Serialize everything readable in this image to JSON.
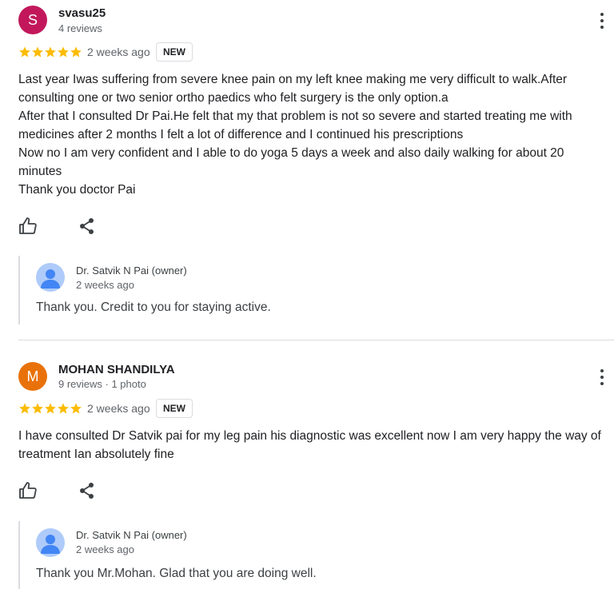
{
  "reviews": [
    {
      "avatar_letter": "S",
      "avatar_color": "#c2185b",
      "name": "svasu25",
      "meta": "4 reviews",
      "rating": 5,
      "date": "2 weeks ago",
      "badge": "NEW",
      "text_lines": [
        "Last year Iwas suffering from severe knee pain on my left knee making me very difficult to walk.After consulting one or two senior ortho paedics who felt surgery is the only option.a",
        "After that I consulted Dr Pai.He felt that my that problem is not so severe and started treating me with medicines after 2 months I felt a lot of difference and I continued his prescriptions",
        "Now no I am very confident and I able to do yoga 5 days a week and also daily walking for about 20 minutes",
        "Thank you doctor Pai"
      ],
      "reply": {
        "owner_name": "Dr. Satvik N Pai (owner)",
        "date": "2 weeks ago",
        "text": "Thank you. Credit to you for staying active."
      }
    },
    {
      "avatar_letter": "M",
      "avatar_color": "#e8710a",
      "name": "MOHAN SHANDILYA",
      "meta": "9 reviews · 1 photo",
      "rating": 5,
      "date": "2 weeks ago",
      "badge": "NEW",
      "text_lines": [
        "I have consulted Dr Satvik pai for my leg pain his diagnostic was excellent now I am very happy the way of treatment Ian absolutely fine"
      ],
      "reply": {
        "owner_name": "Dr. Satvik N Pai (owner)",
        "date": "2 weeks ago",
        "text": "Thank you Mr.Mohan. Glad that you are doing well."
      }
    }
  ],
  "icons": {
    "more": "more-vert-icon",
    "like": "thumb-up-icon",
    "share": "share-icon",
    "owner_avatar": "person-icon",
    "star": "star-icon"
  },
  "colors": {
    "star": "#fbbc04",
    "owner_avatar_bg": "#aecbfa",
    "owner_avatar_fg": "#4285f4"
  }
}
